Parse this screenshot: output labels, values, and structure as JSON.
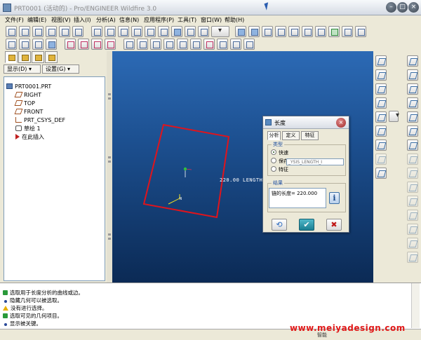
{
  "window": {
    "title": "PRT0001 (活动的) - Pro/ENGINEER Wildfire 3.0",
    "minimize": "–",
    "maximize": "□",
    "close": "×"
  },
  "menu": [
    "文件(F)",
    "编辑(E)",
    "视图(V)",
    "插入(I)",
    "分析(A)",
    "信息(N)",
    "应用程序(P)",
    "工具(T)",
    "窗口(W)",
    "帮助(H)"
  ],
  "left_panel": {
    "show_button": "显示(D) ▾",
    "settings_button": "设置(G) ▾",
    "tree": [
      {
        "label": "PRT0001.PRT",
        "icon": "part-icon"
      },
      {
        "label": "RIGHT",
        "icon": "datum-plane-icon"
      },
      {
        "label": "TOP",
        "icon": "datum-plane-icon"
      },
      {
        "label": "FRONT",
        "icon": "datum-plane-icon"
      },
      {
        "label": "PRT_CSYS_DEF",
        "icon": "csys-icon"
      },
      {
        "label": "草绘 1",
        "icon": "sketch-icon"
      },
      {
        "label": "在此插入",
        "icon": "insert-here-icon"
      }
    ]
  },
  "viewport": {
    "dimension_label": "220.00 LENGTH",
    "axis_label": "N",
    "sketch_color": "#e0141c"
  },
  "dialog": {
    "title": "长度",
    "tabs": [
      "分析",
      "定义",
      "特征"
    ],
    "type_group": "类型",
    "options": [
      {
        "label": "快速",
        "checked": true
      },
      {
        "label": "保存",
        "checked": false
      },
      {
        "label": "特征",
        "checked": false
      }
    ],
    "saved_name": "_YSIS_LENGTH_I",
    "result_group": "结果",
    "result_text": "链的长度= 220.000",
    "info_symbol": "i",
    "repeat_symbol": "⟲",
    "ok_symbol": "✔",
    "cancel_symbol": "✖"
  },
  "messages": [
    {
      "type": "arrow",
      "text": "选取用于长度分析的曲线或边。"
    },
    {
      "type": "bullet",
      "text": "隐藏几何可以被选取。"
    },
    {
      "type": "warn",
      "text": "没有进行选择。"
    },
    {
      "type": "arrow",
      "text": "选取可见的几何项目。"
    },
    {
      "type": "bullet",
      "text": "显示被关键。"
    }
  ],
  "status": {
    "label": "智能",
    "watermark": "www.meiyadesign.com"
  },
  "colors": {
    "viewport_top": "#2c6ab5",
    "viewport_bottom": "#0b2a55",
    "sketch": "#e0141c",
    "watermark": "#e01818"
  }
}
